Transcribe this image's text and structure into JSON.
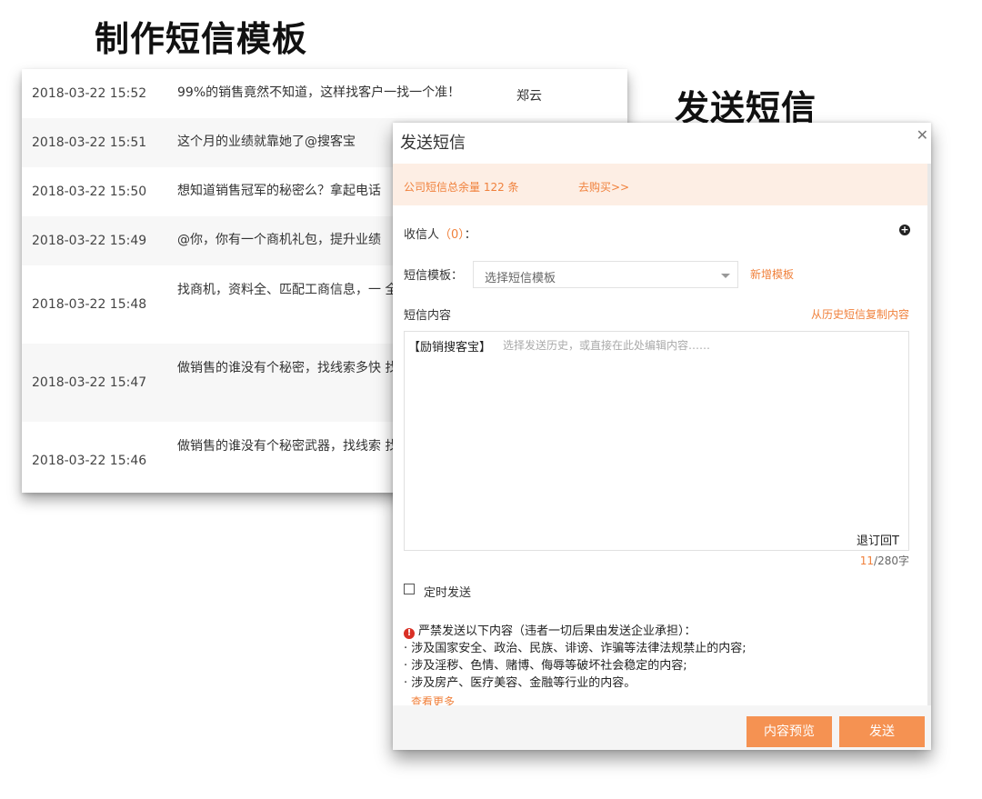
{
  "headings": {
    "make_template": "制作短信模板",
    "send_sms": "发送短信"
  },
  "template_list": {
    "rows": [
      {
        "time": "2018-03-22 15:52",
        "content": "99%的销售竟然不知道，这样找客户一找一个准！",
        "author": "郑云"
      },
      {
        "time": "2018-03-22 15:51",
        "content": "这个月的业绩就靠她了@搜客宝",
        "author": ""
      },
      {
        "time": "2018-03-22 15:50",
        "content": "想知道销售冠军的秘密么？拿起电话",
        "author": ""
      },
      {
        "time": "2018-03-22 15:49",
        "content": "@你，你有一个商机礼包，提升业绩",
        "author": ""
      },
      {
        "time": "2018-03-22 15:48",
        "content": "找商机，资料全、匹配工商信息，一 全部领走",
        "author": ""
      },
      {
        "time": "2018-03-22 15:47",
        "content": "做销售的谁没有个秘密，找线索多快 找我搜一下！",
        "author": ""
      },
      {
        "time": "2018-03-22 15:46",
        "content": "做销售的谁没有个秘密武器，找线索 找我搜一下！",
        "author": ""
      }
    ]
  },
  "dialog": {
    "title": "发送短信",
    "close_icon": "close-icon",
    "notice": {
      "balance_text": "公司短信总余量 122 条",
      "buy_link": "去购买>>"
    },
    "recipient": {
      "label": "收信人",
      "count": "（0）",
      "colon": "："
    },
    "template": {
      "label": "短信模板：",
      "select_value": "选择短信模板",
      "new_template_link": "新增模板"
    },
    "content": {
      "label": "短信内容",
      "copy_history_link": "从历史短信复制内容",
      "prefix": "【励销搜客宝】",
      "placeholder": "选择发送历史，或直接在此处编辑内容……",
      "signature": "退订回T",
      "char_current": "11",
      "char_limit": "/280字"
    },
    "schedule": {
      "label": "定时发送",
      "checked": false
    },
    "warning": {
      "title": "严禁发送以下内容（违者一切后果由发送企业承担）：",
      "items": [
        "· 涉及国家安全、政治、民族、诽谤、诈骗等法律法规禁止的内容;",
        "· 涉及淫秽、色情、赌博、侮辱等破坏社会稳定的内容;",
        "· 涉及房产、医疗美容、金融等行业的内容。"
      ],
      "view_more": "查看更多"
    },
    "buttons": {
      "preview": "内容预览",
      "send": "发送"
    }
  },
  "colors": {
    "accent": "#f0813c",
    "button": "#f59252",
    "notice_bg": "#fdeee4"
  }
}
